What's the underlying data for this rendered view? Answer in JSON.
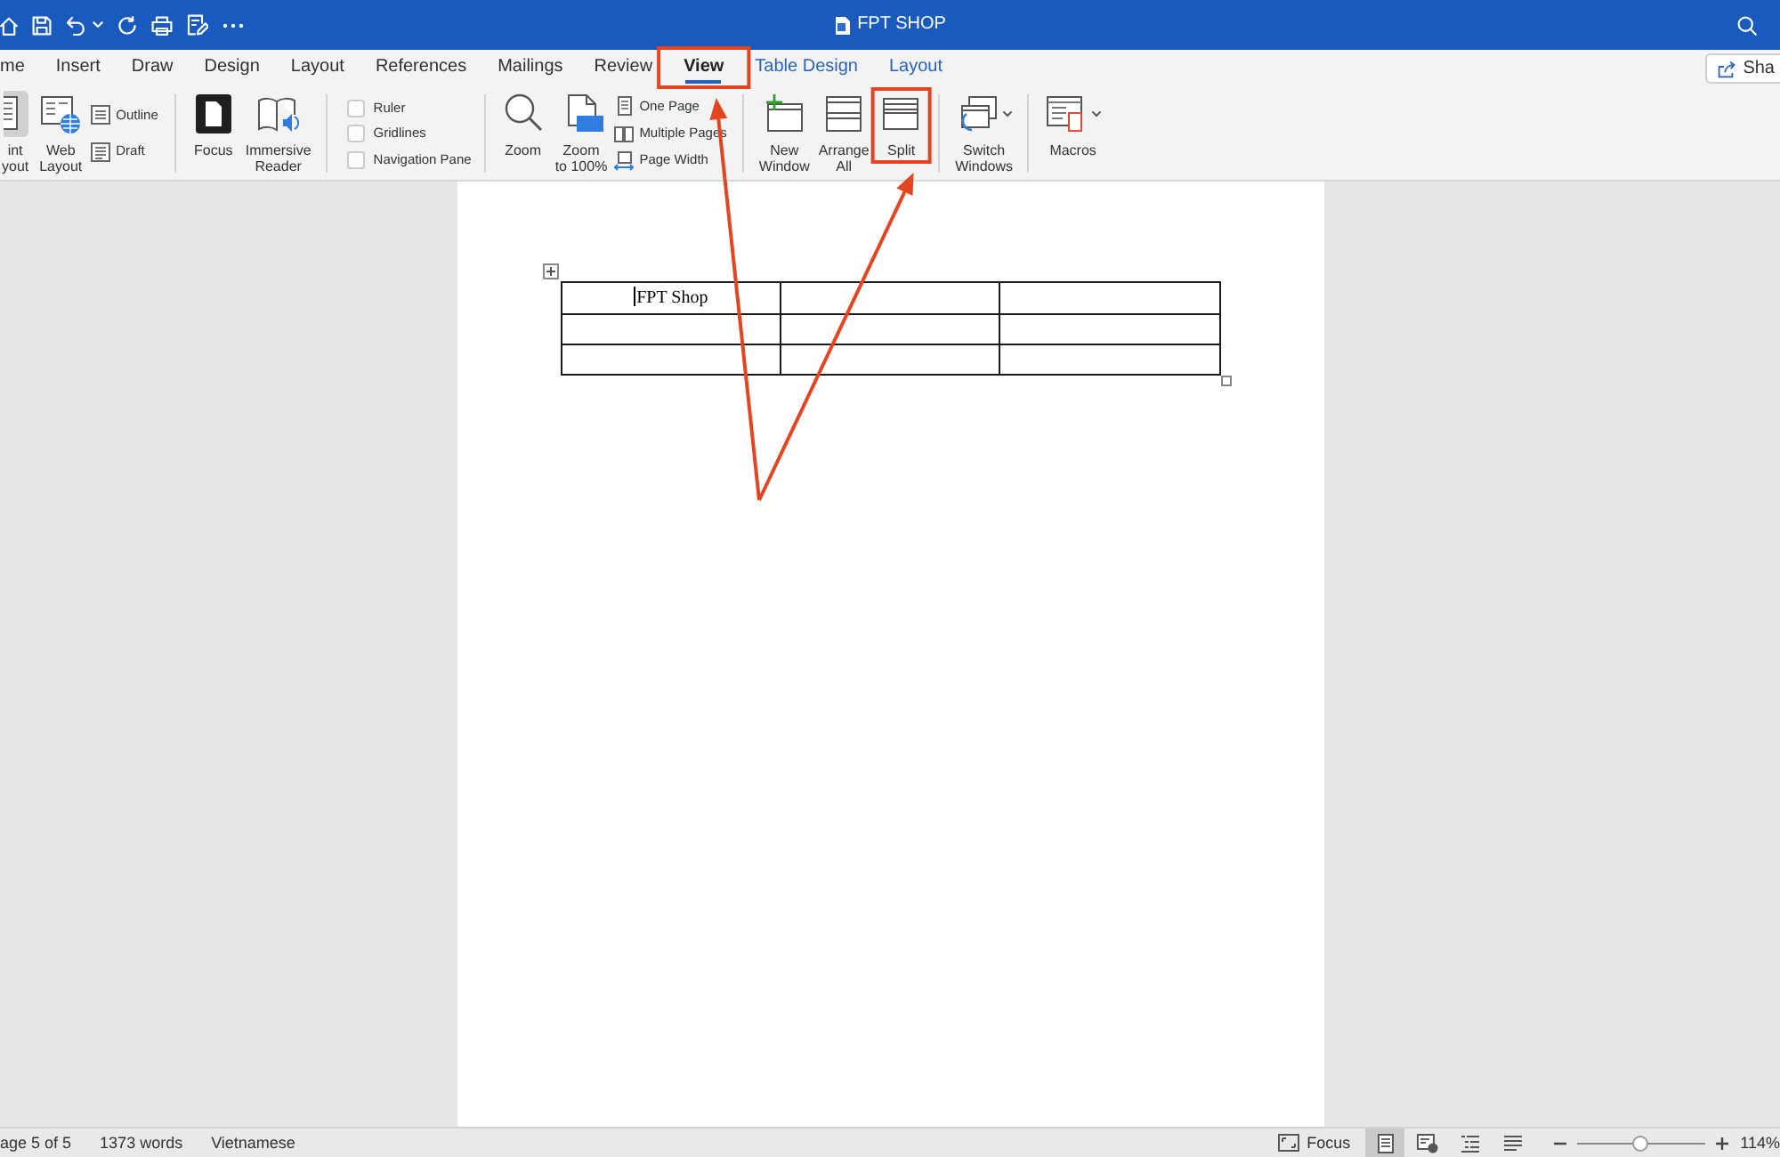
{
  "window": {
    "title": "FPT SHOP"
  },
  "tabs": [
    {
      "label": "me",
      "kind": "standard",
      "selected": false,
      "highlighted": false
    },
    {
      "label": "Insert",
      "kind": "standard",
      "selected": false,
      "highlighted": false
    },
    {
      "label": "Draw",
      "kind": "standard",
      "selected": false,
      "highlighted": false
    },
    {
      "label": "Design",
      "kind": "standard",
      "selected": false,
      "highlighted": false
    },
    {
      "label": "Layout",
      "kind": "standard",
      "selected": false,
      "highlighted": false
    },
    {
      "label": "References",
      "kind": "standard",
      "selected": false,
      "highlighted": false
    },
    {
      "label": "Mailings",
      "kind": "standard",
      "selected": false,
      "highlighted": false
    },
    {
      "label": "Review",
      "kind": "standard",
      "selected": false,
      "highlighted": false
    },
    {
      "label": "View",
      "kind": "standard",
      "selected": true,
      "highlighted": true
    },
    {
      "label": "Table Design",
      "kind": "contextual",
      "selected": false,
      "highlighted": false
    },
    {
      "label": "Layout",
      "kind": "contextual",
      "selected": false,
      "highlighted": false
    }
  ],
  "share_button": {
    "label": "Sha"
  },
  "ribbon": {
    "groups": [
      {
        "items": [
          {
            "kind": "large",
            "lines": [
              "int",
              "yout"
            ],
            "selected": true,
            "highlighted": false
          },
          {
            "kind": "large",
            "lines": [
              "Web",
              "Layout"
            ],
            "selected": false,
            "highlighted": false
          },
          {
            "kind": "stack",
            "items": [
              {
                "label": "Outline",
                "selected": false
              },
              {
                "label": "Draft",
                "selected": false
              }
            ]
          }
        ]
      },
      {
        "items": [
          {
            "kind": "large",
            "lines": [
              "Focus"
            ],
            "highlighted": false
          },
          {
            "kind": "large",
            "lines": [
              "Immersive",
              "Reader"
            ],
            "highlighted": false
          }
        ]
      },
      {
        "items": [
          {
            "kind": "checks",
            "items": [
              {
                "label": "Ruler",
                "checked": false
              },
              {
                "label": "Gridlines",
                "checked": false
              },
              {
                "label": "Navigation Pane",
                "checked": false
              }
            ]
          }
        ]
      },
      {
        "items": [
          {
            "kind": "large",
            "lines": [
              "Zoom"
            ],
            "highlighted": false
          },
          {
            "kind": "large",
            "lines": [
              "Zoom",
              "to 100%"
            ],
            "highlighted": false
          },
          {
            "kind": "stack",
            "items": [
              {
                "label": "One Page"
              },
              {
                "label": "Multiple Pages"
              },
              {
                "label": "Page Width"
              }
            ]
          }
        ]
      },
      {
        "items": [
          {
            "kind": "large",
            "lines": [
              "New",
              "Window"
            ],
            "highlighted": false
          },
          {
            "kind": "large",
            "lines": [
              "Arrange",
              "All"
            ],
            "highlighted": false
          },
          {
            "kind": "large",
            "lines": [
              "Split"
            ],
            "highlighted": true
          }
        ]
      },
      {
        "items": [
          {
            "kind": "menu",
            "lines": [
              "Switch",
              "Windows"
            ],
            "highlighted": false
          }
        ]
      },
      {
        "items": [
          {
            "kind": "menu",
            "lines": [
              "Macros"
            ],
            "highlighted": false
          }
        ]
      }
    ]
  },
  "document_table": {
    "rows": [
      {
        "cells": [
          {
            "text": "FPT Shop",
            "caret": true
          },
          {
            "caret": false
          },
          {
            "caret": false
          }
        ]
      },
      {
        "cells": [
          {
            "caret": false
          },
          {
            "caret": false
          },
          {
            "caret": false
          }
        ]
      },
      {
        "cells": [
          {
            "caret": false
          },
          {
            "caret": false
          },
          {
            "caret": false
          }
        ]
      }
    ]
  },
  "status_bar": {
    "texts": [
      "age 5 of 5",
      "1373 words",
      "Vietnamese"
    ],
    "focus_button": {
      "label": "Focus"
    },
    "view_buttons": [
      {
        "selected": true
      },
      {
        "selected": false
      },
      {
        "selected": false
      },
      {
        "selected": false
      }
    ],
    "zoom": {
      "level": 0.5,
      "reading": "114%"
    }
  }
}
